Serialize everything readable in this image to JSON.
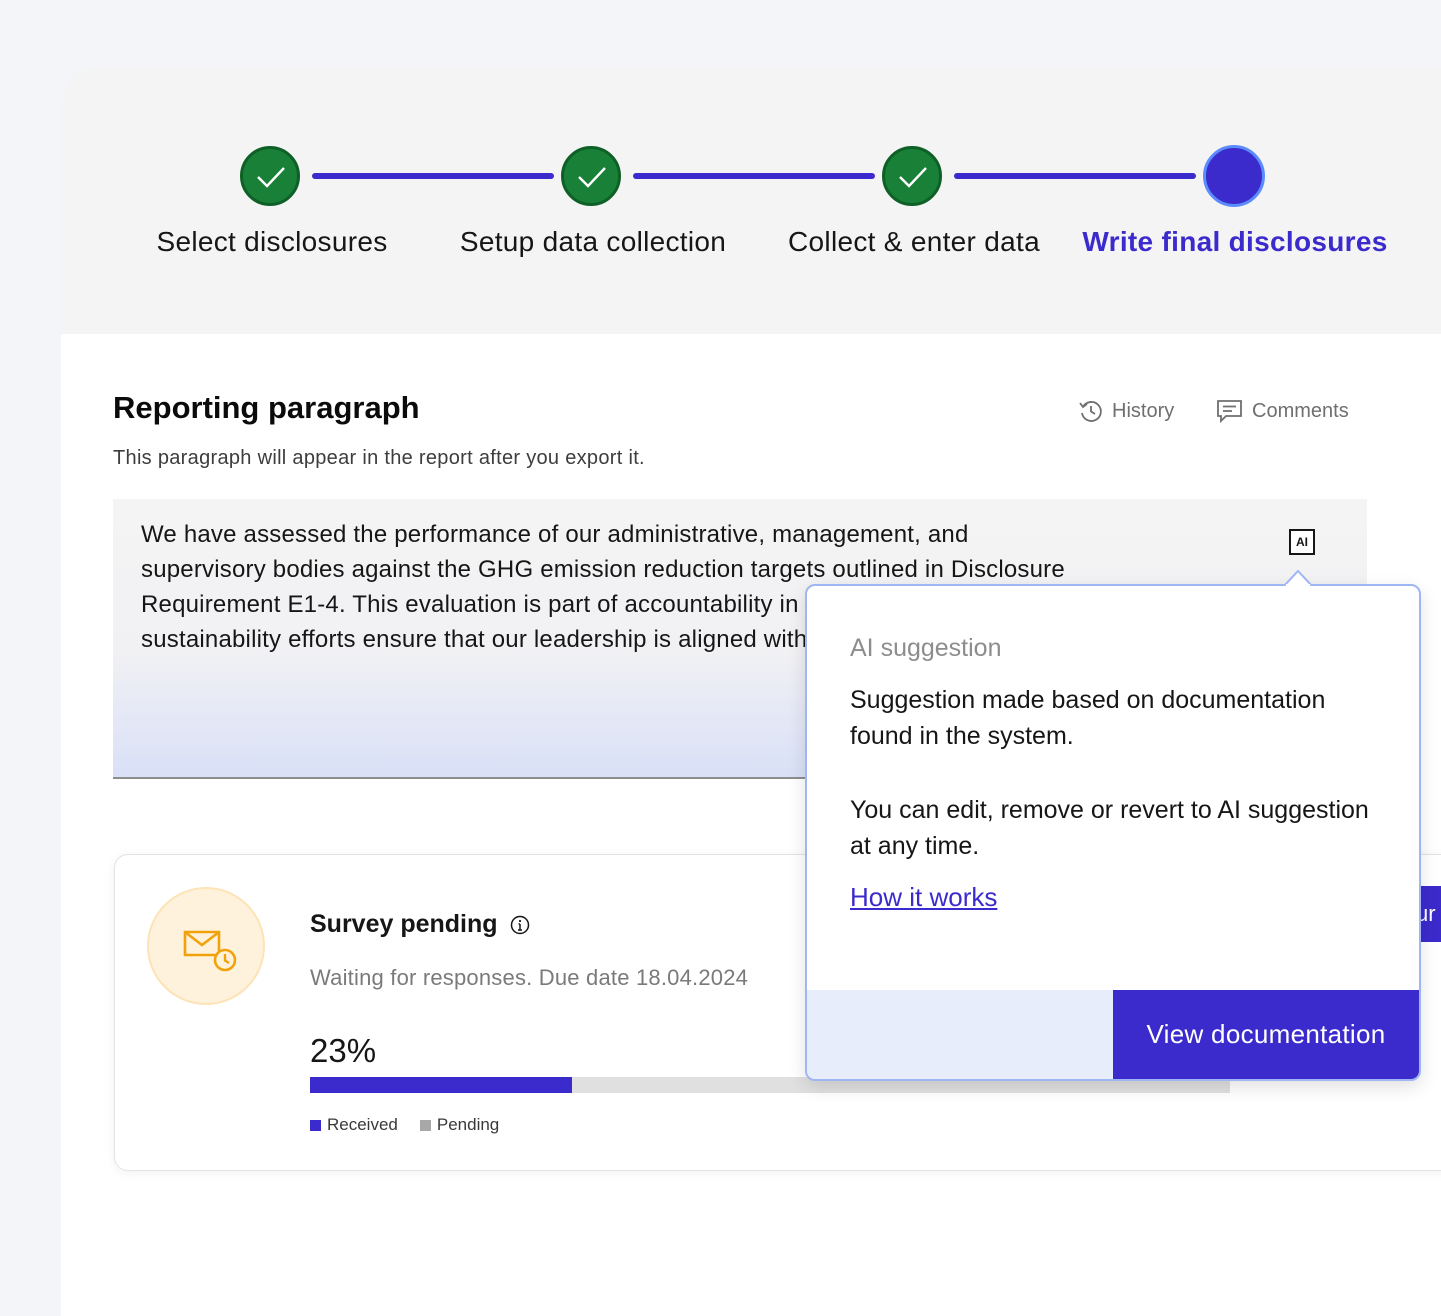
{
  "stepper": {
    "steps": [
      {
        "label": "Select disclosures",
        "state": "done"
      },
      {
        "label": "Setup data collection",
        "state": "done"
      },
      {
        "label": "Collect & enter data",
        "state": "done"
      },
      {
        "label": "Write final disclosures",
        "state": "active"
      }
    ]
  },
  "section": {
    "title": "Reporting paragraph",
    "subtitle": "This paragraph will appear in the report after you export it.",
    "history_label": "History",
    "comments_label": "Comments"
  },
  "paragraph": {
    "text": "We have assessed the performance of our administrative, management, and supervisory bodies against the GHG emission reduction targets outlined in Disclosure Requirement E1-4. This evaluation is part of accountability in our environmental sustainability efforts ensure that our leadership is aligned with our goals for r",
    "ai_badge": "AI"
  },
  "ai_popover": {
    "label": "AI suggestion",
    "body_1": "Suggestion made based on documentation found in the system.",
    "body_2": "You can edit, remove or revert to AI suggestion at any time.",
    "link": "How it works",
    "button": "View documentation"
  },
  "survey": {
    "title": "Survey pending",
    "subtitle": "Waiting for responses. Due date 18.04.2024",
    "percent_label": "23%",
    "progress_fraction": 0.285,
    "legend_received": "Received",
    "legend_pending": "Pending",
    "side_button_fragment": "ur"
  },
  "colors": {
    "accent": "#3c2bcc",
    "success": "#198038",
    "pending_gray": "#a8a8a8",
    "warning_icon": "#f1a20a"
  }
}
